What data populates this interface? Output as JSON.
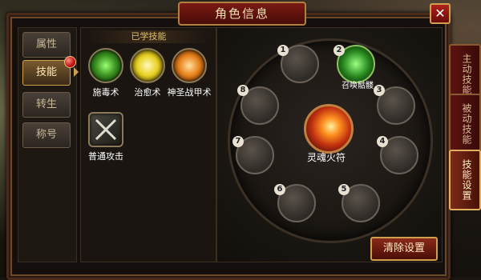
{
  "window": {
    "title": "角色信息",
    "close_label": "✕"
  },
  "left_menu": [
    {
      "label": "属性",
      "active": false
    },
    {
      "label": "技能",
      "active": true
    },
    {
      "label": "转生",
      "active": false
    },
    {
      "label": "称号",
      "active": false
    }
  ],
  "skills_panel": {
    "header": "已学技能",
    "skills": [
      {
        "label": "施毒术",
        "icon": "poison-skull-icon",
        "color": "#4aa030"
      },
      {
        "label": "治愈术",
        "icon": "heal-light-icon",
        "color": "#d8c020"
      },
      {
        "label": "神圣战甲术",
        "icon": "holy-armor-icon",
        "color": "#e0801a"
      },
      {
        "label": "普通攻击",
        "icon": "crossed-swords-icon",
        "color": "#6a6a60"
      }
    ]
  },
  "wheel": {
    "center_label": "灵魂火符",
    "summon_label": "召唤骷髅",
    "slots": [
      "1",
      "2",
      "3",
      "4",
      "5",
      "6",
      "7",
      "8"
    ]
  },
  "clear_button": "清除设置",
  "right_tabs": [
    {
      "label": "主动技能",
      "active": false
    },
    {
      "label": "被动技能",
      "active": false
    },
    {
      "label": "技能设置",
      "active": true
    }
  ]
}
